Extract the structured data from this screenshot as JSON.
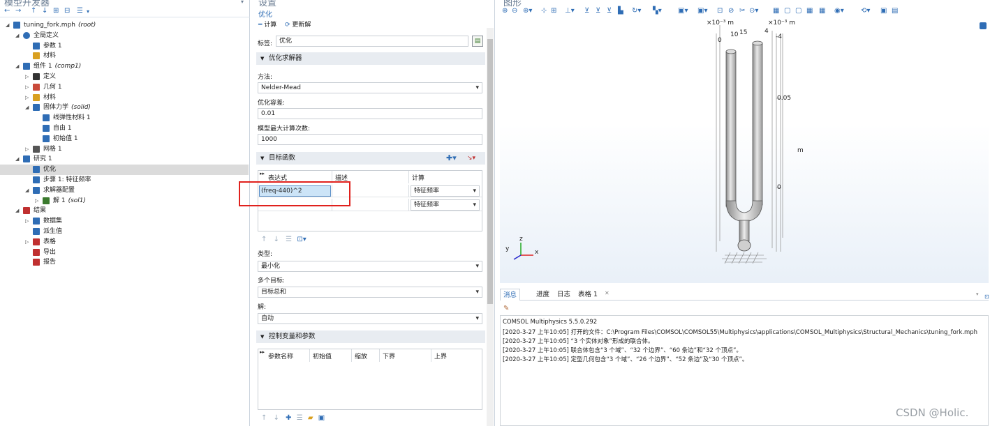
{
  "left_panel": {
    "title": "模型开发器",
    "pin": "▾",
    "toolbar": [
      "←",
      "→",
      "↑",
      "↓",
      "⊞",
      "⊟",
      "☰",
      "▾"
    ],
    "tree": [
      {
        "twist": "◢",
        "icon": "root-icon",
        "label": "tuning_fork.mph",
        "italic": "(root)",
        "indent": 0,
        "sel": false
      },
      {
        "twist": "◢",
        "icon": "globe-icon",
        "label": "全局定义",
        "italic": "",
        "indent": 1,
        "sel": false
      },
      {
        "twist": "",
        "icon": "pi-icon",
        "label": "参数 1",
        "italic": "",
        "indent": 2,
        "sel": false
      },
      {
        "twist": "",
        "icon": "material-icon",
        "label": "材料",
        "italic": "",
        "indent": 2,
        "sel": false
      },
      {
        "twist": "◢",
        "icon": "component-icon",
        "label": "组件 1",
        "italic": "(comp1)",
        "indent": 1,
        "sel": false
      },
      {
        "twist": "▷",
        "icon": "definitions-icon",
        "label": "定义",
        "italic": "",
        "indent": 2,
        "sel": false
      },
      {
        "twist": "▷",
        "icon": "geometry-icon",
        "label": "几何 1",
        "italic": "",
        "indent": 2,
        "sel": false
      },
      {
        "twist": "▷",
        "icon": "material-icon",
        "label": "材料",
        "italic": "",
        "indent": 2,
        "sel": false
      },
      {
        "twist": "◢",
        "icon": "solid-mechanics-icon",
        "label": "固体力学",
        "italic": "(solid)",
        "indent": 2,
        "sel": false
      },
      {
        "twist": "",
        "icon": "domain-node-icon",
        "label": "线弹性材料 1",
        "italic": "",
        "indent": 3,
        "sel": false
      },
      {
        "twist": "",
        "icon": "boundary-node-icon",
        "label": "自由 1",
        "italic": "",
        "indent": 3,
        "sel": false
      },
      {
        "twist": "",
        "icon": "domain-node-icon",
        "label": "初始值 1",
        "italic": "",
        "indent": 3,
        "sel": false
      },
      {
        "twist": "▷",
        "icon": "mesh-icon",
        "label": "网格 1",
        "italic": "",
        "indent": 2,
        "sel": false
      },
      {
        "twist": "◢",
        "icon": "study-icon",
        "label": "研究 1",
        "italic": "",
        "indent": 1,
        "sel": false
      },
      {
        "twist": "",
        "icon": "optimization-icon",
        "label": "优化",
        "italic": "",
        "indent": 2,
        "sel": true
      },
      {
        "twist": "",
        "icon": "eigenfrequency-icon",
        "label": "步骤 1: 特征频率",
        "italic": "",
        "indent": 2,
        "sel": false
      },
      {
        "twist": "◢",
        "icon": "solver-config-icon",
        "label": "求解器配置",
        "italic": "",
        "indent": 2,
        "sel": false
      },
      {
        "twist": "▷",
        "icon": "solution-icon",
        "label": "解 1",
        "italic": "(sol1)",
        "indent": 3,
        "sel": false
      },
      {
        "twist": "◢",
        "icon": "results-icon",
        "label": "结果",
        "italic": "",
        "indent": 1,
        "sel": false
      },
      {
        "twist": "▷",
        "icon": "dataset-icon",
        "label": "数据集",
        "italic": "",
        "indent": 2,
        "sel": false
      },
      {
        "twist": "",
        "icon": "derived-values-icon",
        "label": "派生值",
        "italic": "",
        "indent": 2,
        "sel": false
      },
      {
        "twist": "▷",
        "icon": "table-icon",
        "label": "表格",
        "italic": "",
        "indent": 2,
        "sel": false
      },
      {
        "twist": "",
        "icon": "export-icon",
        "label": "导出",
        "italic": "",
        "indent": 2,
        "sel": false
      },
      {
        "twist": "",
        "icon": "report-icon",
        "label": "报告",
        "italic": "",
        "indent": 2,
        "sel": false
      }
    ]
  },
  "settings": {
    "title": "设置",
    "subtitle": "优化",
    "compute_label": "计算",
    "update_label": "更新解",
    "tag_label": "标签:",
    "tag_value": "优化",
    "solver_section": "优化求解器",
    "method_label": "方法:",
    "method_value": "Nelder-Mead",
    "tolerance_label": "优化容差:",
    "tolerance_value": "0.01",
    "maxeval_label": "模型最大计算次数:",
    "maxeval_value": "1000",
    "objective_section": "目标函数",
    "obj_headers": [
      "表达式",
      "描述",
      "计算"
    ],
    "obj_rows": [
      {
        "expr": "(freq-440)^2",
        "desc": "",
        "eval": "特征频率"
      },
      {
        "expr": "",
        "desc": "",
        "eval": "特征频率"
      }
    ],
    "type_label": "类型:",
    "type_value": "最小化",
    "multi_label": "多个目标:",
    "multi_value": "目标总和",
    "solution_label": "解:",
    "solution_value": "自动",
    "control_section": "控制变量和参数",
    "ctrl_headers": [
      "参数名称",
      "初始值",
      "缩放",
      "下界",
      "上界"
    ]
  },
  "graphics": {
    "title": "图形",
    "axis_top_left": "×10⁻³ m",
    "axis_top_right": "×10⁻³ m",
    "tick_0": "0",
    "tick_10": "10",
    "tick_15": "15",
    "tick_4": "4",
    "tick_m4": "-4",
    "tick_005": "0.05",
    "tick_m": "m",
    "tick_zero": "0",
    "triad_x": "x",
    "triad_y": "y",
    "triad_z": "z"
  },
  "messages": {
    "tabs": [
      "消息",
      "进度",
      "日志",
      "表格 1"
    ],
    "lines": [
      "COMSOL Multiphysics 5.5.0.292",
      "[2020-3-27 上午10:05] 打开的文件：C:\\Program Files\\COMSOL\\COMSOL55\\Multiphysics\\applications\\COMSOL_Multiphysics\\Structural_Mechanics\\tuning_fork.mph",
      "[2020-3-27 上午10:05] “3 个实体对象”形成的联合体。",
      "[2020-3-27 上午10:05] 联合体包含“3 个域”、“32 个边界”、“60 条边”和“32 个顶点”。",
      "[2020-3-27 上午10:05] 定型几何包含“3 个域”、“26 个边界”、“52 条边”及“30 个顶点”。"
    ]
  },
  "watermark": "CSDN @Holic.",
  "colors": {
    "accent": "#2f6db5",
    "highlight_box": "#e0211d",
    "selected_cell": "#cce4f7"
  }
}
